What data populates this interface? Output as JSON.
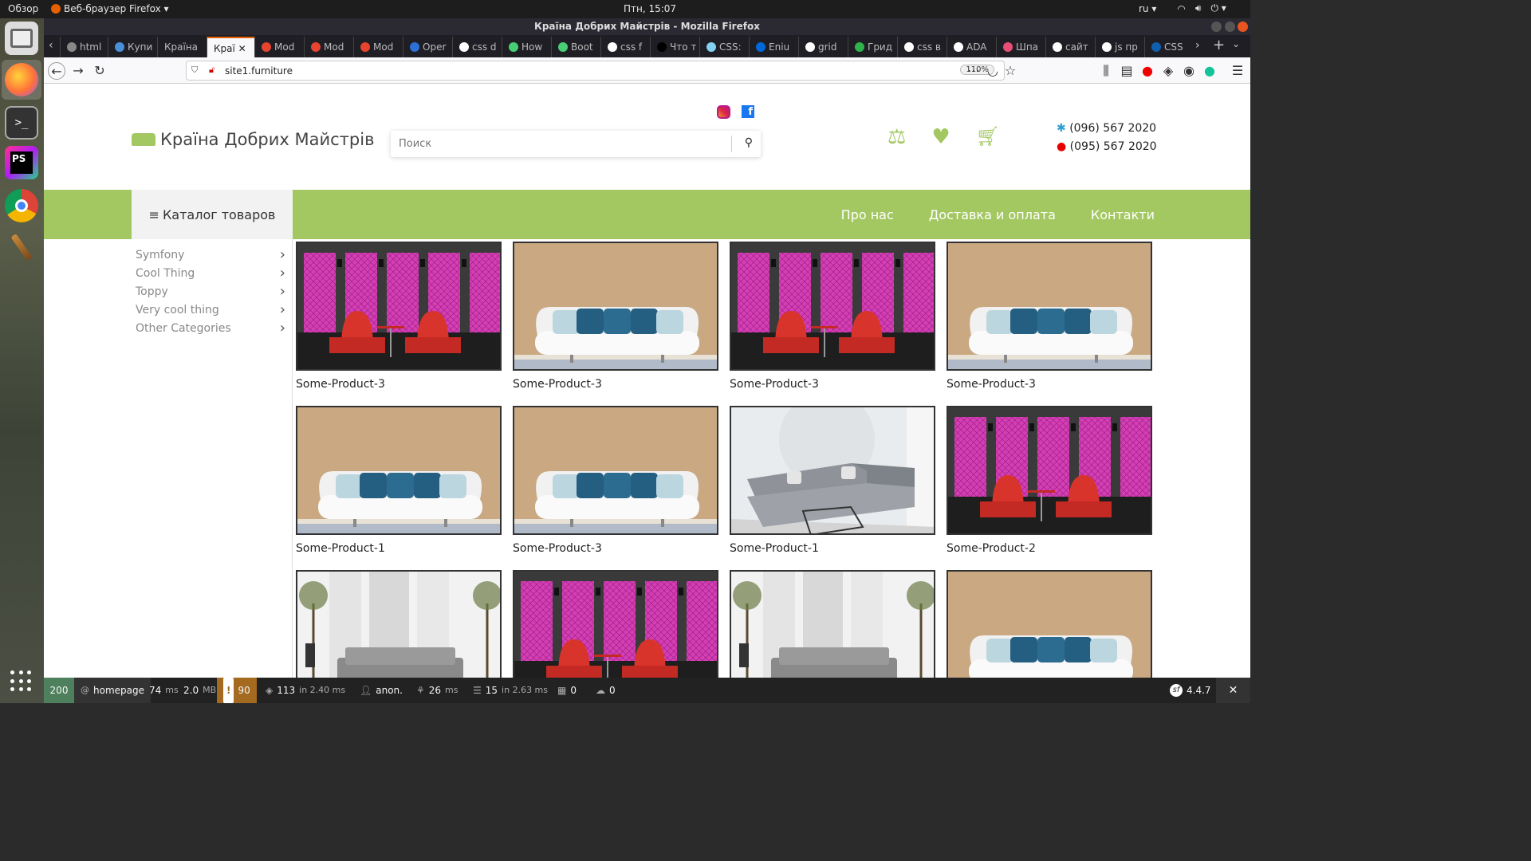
{
  "os": {
    "activities": "Обзор",
    "app_menu": "Веб-браузер Firefox",
    "clock": "Птн, 15:07",
    "keyboard_layout": "ru"
  },
  "window": {
    "title": "Країна Добрих Майстрів - Mozilla Firefox"
  },
  "tabs": [
    {
      "label": "html",
      "icon": "generic-icon",
      "color": "#888888"
    },
    {
      "label": "Купи",
      "icon": "bot-icon",
      "color": "#4a90d9"
    },
    {
      "label": "Країна",
      "icon": "",
      "color": ""
    },
    {
      "label": "Краї",
      "icon": "",
      "color": "",
      "active": true
    },
    {
      "label": "Mod",
      "icon": "laravel-icon",
      "color": "#e74430"
    },
    {
      "label": "Mod",
      "icon": "laravel-icon",
      "color": "#e74430"
    },
    {
      "label": "Mod",
      "icon": "laravel-icon",
      "color": "#e74430"
    },
    {
      "label": "Oper",
      "icon": "f-icon",
      "color": "#2e6fd8"
    },
    {
      "label": "css d",
      "icon": "google-icon",
      "color": "#ffffff"
    },
    {
      "label": "How",
      "icon": "codepen-icon",
      "color": "#47cf73"
    },
    {
      "label": "Boot",
      "icon": "codepen-icon",
      "color": "#47cf73"
    },
    {
      "label": "css f",
      "icon": "google-icon",
      "color": "#ffffff"
    },
    {
      "label": "Что т",
      "icon": "medium-icon",
      "color": "#000000"
    },
    {
      "label": "CSS:",
      "icon": "mdn-icon",
      "color": "#83d0f2"
    },
    {
      "label": "Eniu",
      "icon": "github-icon",
      "color": "#0069d9"
    },
    {
      "label": "grid",
      "icon": "google-icon",
      "color": "#ffffff"
    },
    {
      "label": "Грид",
      "icon": "p-icon",
      "color": "#2fb24c"
    },
    {
      "label": "css в",
      "icon": "google-icon",
      "color": "#ffffff"
    },
    {
      "label": "ADA",
      "icon": "ada-icon",
      "color": "#ffffff"
    },
    {
      "label": "Шпа",
      "icon": "wiki-icon",
      "color": "#e94e77"
    },
    {
      "label": "сайт",
      "icon": "google-icon",
      "color": "#ffffff"
    },
    {
      "label": "js пр",
      "icon": "google-icon",
      "color": "#ffffff"
    },
    {
      "label": "CSS",
      "icon": "o-icon",
      "color": "#0f5fae"
    }
  ],
  "navbar": {
    "url": "site1.furniture",
    "zoom": "110%"
  },
  "site": {
    "brand": "Країна Добрих Майстрів",
    "search_placeholder": "Поиск",
    "phone_1": "(096) 567 2020",
    "phone_2": "(095) 567 2020",
    "catalog_label": "Каталог товаров",
    "nav": [
      "Про нас",
      "Доставка и оплата",
      "Контакти"
    ],
    "accent": "#a3c862",
    "categories": [
      "Symfony",
      "Cool Thing",
      "Toppy",
      "Very cool thing",
      "Other Categories"
    ],
    "products": [
      {
        "name": "Some-Product-3",
        "image": "pink-booth"
      },
      {
        "name": "Some-Product-3",
        "image": "white-sofa"
      },
      {
        "name": "Some-Product-3",
        "image": "pink-booth"
      },
      {
        "name": "Some-Product-3",
        "image": "white-sofa"
      },
      {
        "name": "Some-Product-1",
        "image": "white-sofa"
      },
      {
        "name": "Some-Product-3",
        "image": "white-sofa"
      },
      {
        "name": "Some-Product-1",
        "image": "grey-corner-sofa"
      },
      {
        "name": "Some-Product-2",
        "image": "pink-booth"
      },
      {
        "name": "",
        "image": "grey-sofa-room"
      },
      {
        "name": "",
        "image": "pink-booth"
      },
      {
        "name": "",
        "image": "grey-sofa-room"
      },
      {
        "name": "",
        "image": "white-sofa"
      }
    ]
  },
  "symfony_toolbar": {
    "status": "200",
    "route": "homepage",
    "time_ms": "74",
    "time_unit": "ms",
    "memory": "2.0",
    "memory_unit": "MB",
    "logs": "90",
    "cache": "113",
    "cache_detail": "in 2.40 ms",
    "user": "anon.",
    "twig_ms": "26",
    "twig_unit": "ms",
    "db_queries": "15",
    "db_detail": "in 2.63 ms",
    "forms": "0",
    "mailer": "0",
    "version": "4.4.7"
  }
}
